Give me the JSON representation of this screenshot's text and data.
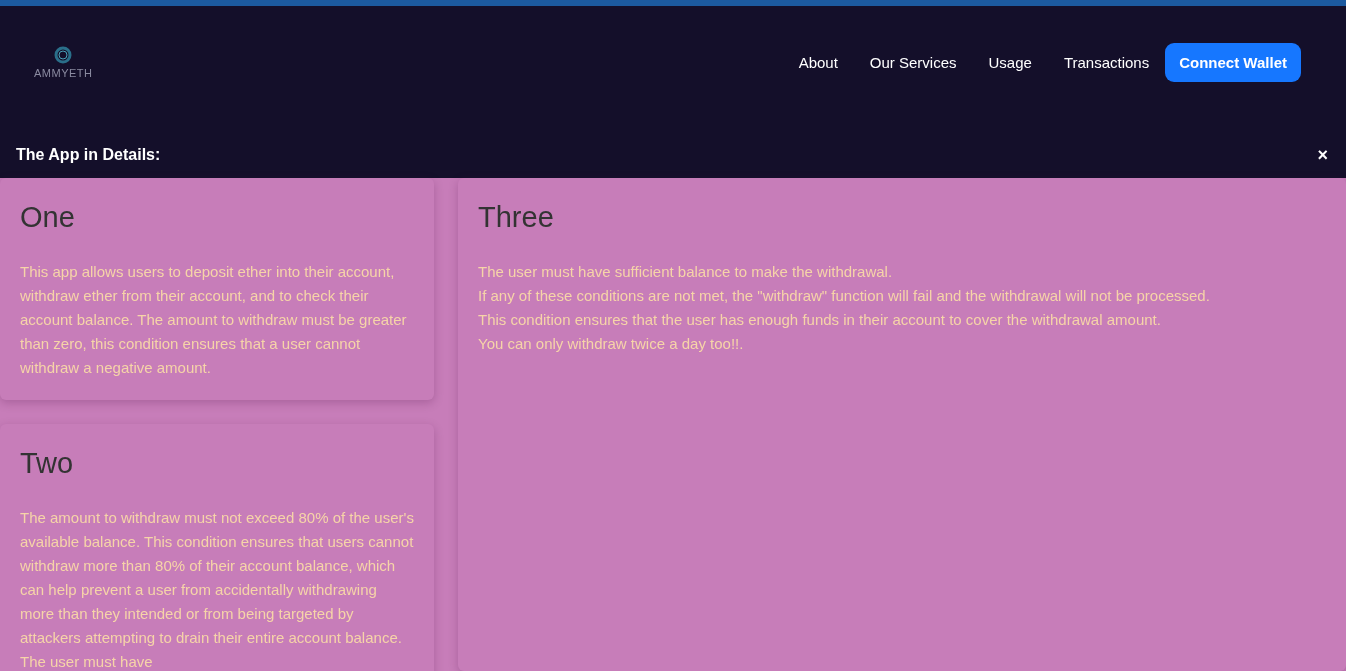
{
  "logo": {
    "name": "AMMYETH"
  },
  "nav": [
    {
      "label": "About"
    },
    {
      "label": "Our Services"
    },
    {
      "label": "Usage"
    },
    {
      "label": "Transactions"
    }
  ],
  "connect_button": "Connect Wallet",
  "panel": {
    "title": "The App in Details:",
    "close": "×"
  },
  "sections": [
    {
      "title": "One",
      "lines": [
        "This app allows users to deposit ether into their account, withdraw ether from their account, and to check their account balance. The amount to withdraw must be greater than zero, this condition ensures that a user cannot withdraw a negative amount."
      ]
    },
    {
      "title": "Two",
      "lines": [
        "The amount to withdraw must not exceed 80% of the user's available balance. This condition ensures that users cannot withdraw more than 80% of their account balance, which can help prevent a user from accidentally withdrawing more than they intended or from being targeted by attackers attempting to drain their entire account balance. The user must have"
      ]
    },
    {
      "title": "Three",
      "lines": [
        "The user must have sufficient balance to make the withdrawal.",
        "If any of these conditions are not met, the \"withdraw\" function will fail and the withdrawal will not be processed.",
        "This condition ensures that the user has enough funds in their account to cover the withdrawal amount.",
        "You can only withdraw twice a day too!!."
      ]
    }
  ]
}
